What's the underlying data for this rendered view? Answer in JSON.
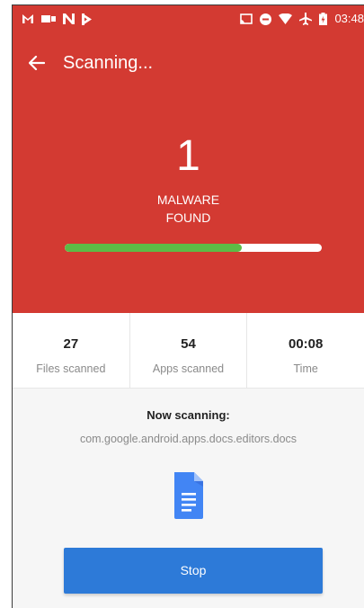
{
  "status_bar": {
    "time": "03:48",
    "left_icons": [
      "gmail-icon",
      "cast-icon",
      "notification-icon",
      "download-icon"
    ],
    "right_icons": [
      "screen-cast-icon",
      "do-not-disturb-icon",
      "wifi-icon",
      "airplane-mode-icon",
      "battery-icon"
    ]
  },
  "header": {
    "title": "Scanning...",
    "back_icon": "arrow-back-icon"
  },
  "result": {
    "count": "1",
    "label_line1": "MALWARE",
    "label_line2": "FOUND",
    "progress_fraction": 0.69
  },
  "stats": [
    {
      "value": "27",
      "label": "Files scanned"
    },
    {
      "value": "54",
      "label": "Apps scanned"
    },
    {
      "value": "00:08",
      "label": "Time"
    }
  ],
  "scanning": {
    "label": "Now scanning:",
    "package": "com.google.android.apps.docs.editors.docs",
    "app_icon": "google-docs-icon"
  },
  "actions": {
    "stop_label": "Stop"
  },
  "colors": {
    "header_red": "#d33a32",
    "progress_green": "#5dbb46",
    "button_blue": "#2d7ad8",
    "docs_blue": "#4285f4"
  }
}
